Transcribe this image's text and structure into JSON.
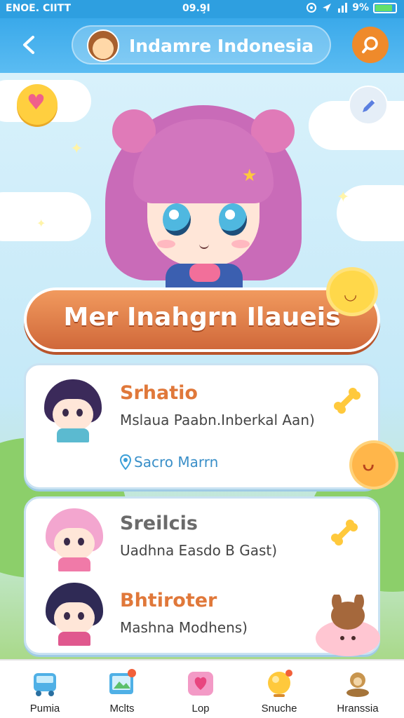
{
  "status_bar": {
    "carrier": "ENOE. CIITT",
    "time": "09.9̧I",
    "battery": "9%"
  },
  "header": {
    "title": "Indamre Indonesia",
    "back_icon": "chevron-left-icon",
    "search_icon": "search-icon"
  },
  "profile": {
    "name": "Mer Inahgrn Ilaueis"
  },
  "items": [
    {
      "title": "Srhatio",
      "subtitle": "Mslaua Paabn.Inberkal Aan)",
      "location": "Sacro Marrn",
      "title_color": "#e0783a"
    },
    {
      "title": "Sreilcis",
      "subtitle": "Uadhna Easdo B Gast)",
      "title_color": "#6a6a6a"
    },
    {
      "title": "Bhtiroter",
      "subtitle": "Mashna Modhens)",
      "title_color": "#e0783a"
    }
  ],
  "bottom_nav": [
    {
      "label": "Pumia",
      "icon": "bus-icon"
    },
    {
      "label": "Mclts",
      "icon": "photo-icon"
    },
    {
      "label": "Lop",
      "icon": "heart-icon"
    },
    {
      "label": "Snuche",
      "icon": "bell-icon"
    },
    {
      "label": "Hranssia",
      "icon": "profile-icon"
    }
  ],
  "colors": {
    "header_blue": "#3aa9ea",
    "banner_orange": "#d9703f",
    "accent_yellow": "#ffd84a"
  }
}
